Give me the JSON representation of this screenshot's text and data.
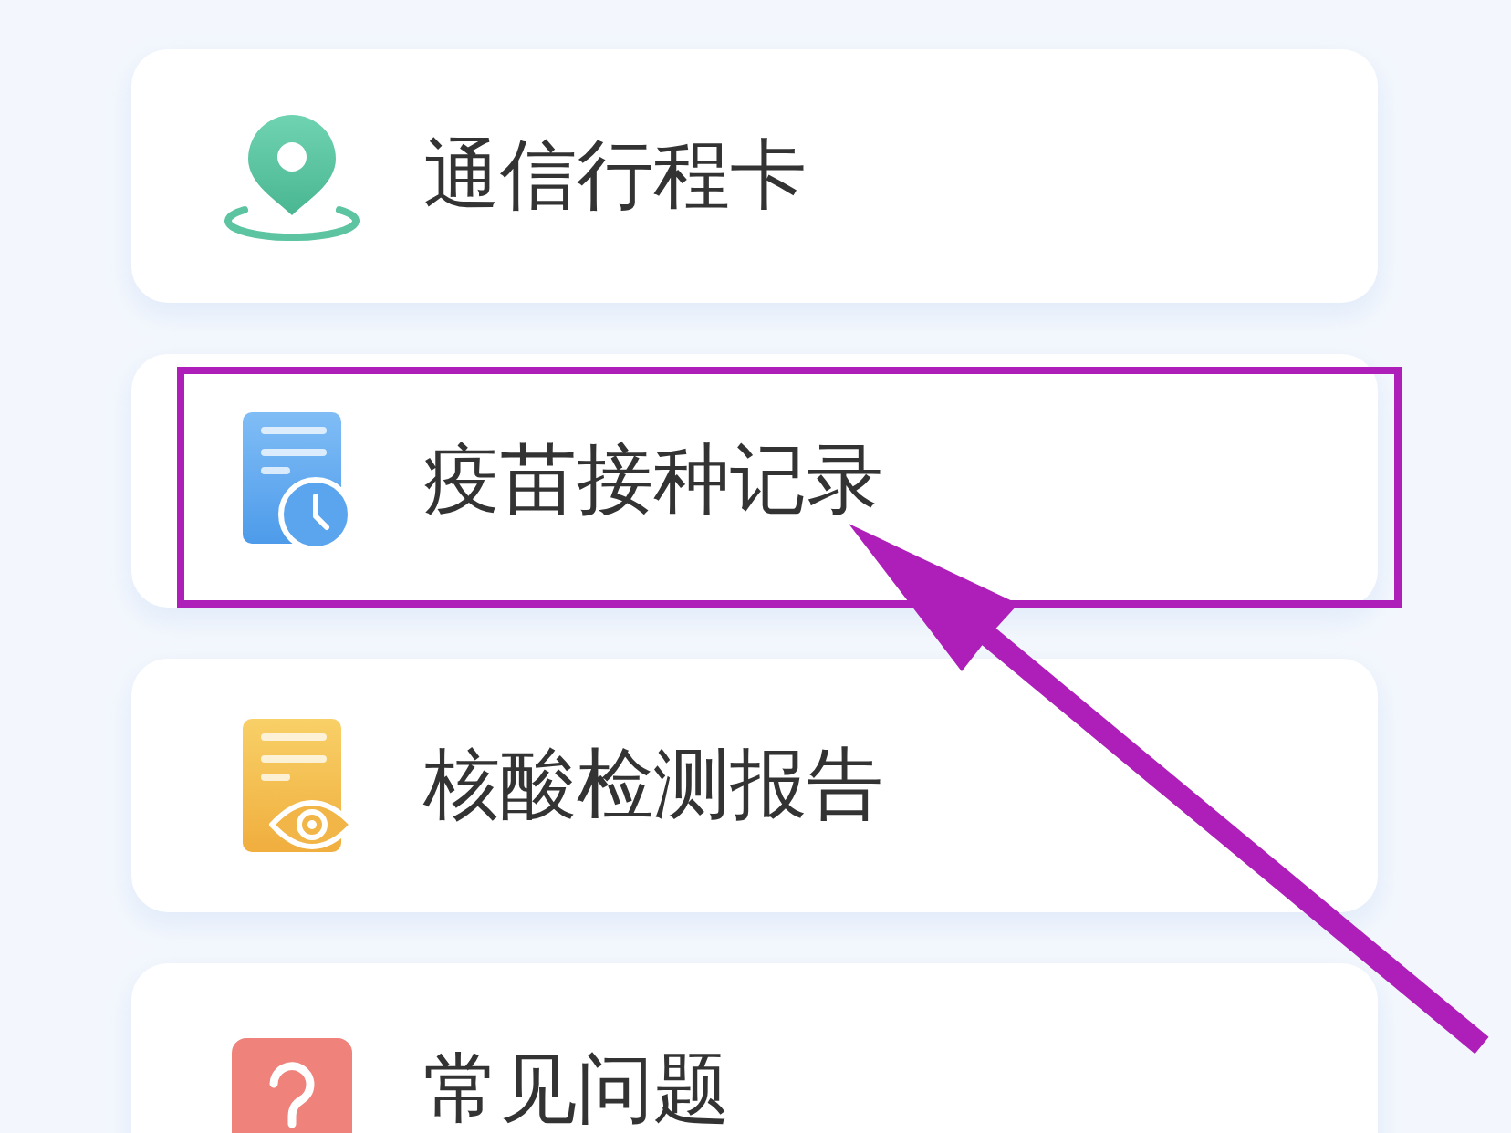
{
  "items": [
    {
      "kind": "itinerary",
      "label": "通信行程卡",
      "highlighted": false
    },
    {
      "kind": "vaccination",
      "label": "疫苗接种记录",
      "highlighted": true
    },
    {
      "kind": "testing",
      "label": "核酸检测报告",
      "highlighted": false
    },
    {
      "kind": "help",
      "label": "常见问题",
      "highlighted": false
    }
  ]
}
